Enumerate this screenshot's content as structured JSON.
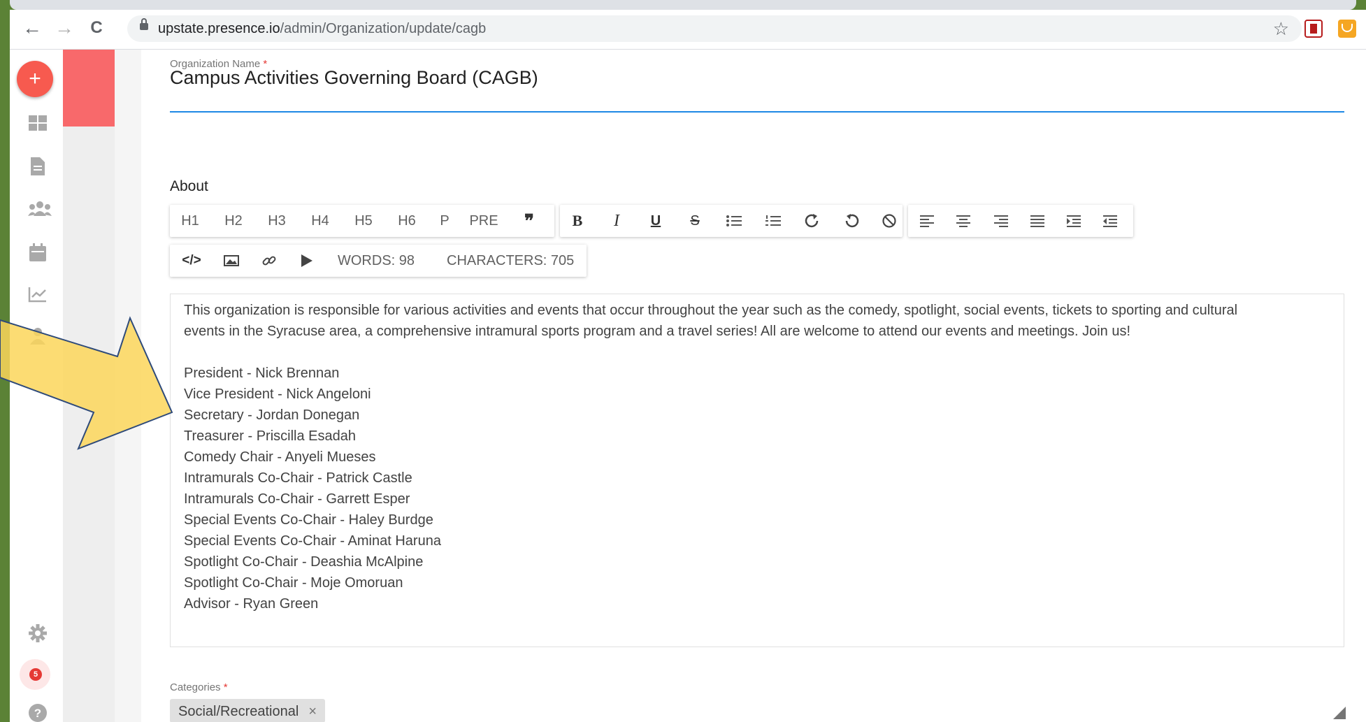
{
  "browser": {
    "url_domain": "upstate.presence.io",
    "url_path": "/admin/Organization/update/cagb",
    "back_icon": "←",
    "forward_icon": "→",
    "reload_icon": "C",
    "star_icon": "☆"
  },
  "sidebar": {
    "add_label": "+",
    "notification_count": "5"
  },
  "form": {
    "org_name_label": "Organization Name",
    "required_mark": "*",
    "org_name_value": "Campus Activities Governing Board (CAGB)",
    "about_label": "About",
    "toolbar": {
      "group1": [
        "H1",
        "H2",
        "H3",
        "H4",
        "H5",
        "H6",
        "P",
        "PRE",
        "❞"
      ],
      "group2": [
        "B",
        "I",
        "U",
        "S"
      ],
      "words": "WORDS: 98",
      "characters": "CHARACTERS: 705",
      "code_label": "</>"
    },
    "about_text": {
      "paragraph_line1": "This organization is responsible for various activities and events that occur throughout the year such as the comedy, spotlight, social events, tickets to sporting and cultural",
      "paragraph_line2": "events in the Syracuse area, a comprehensive intramural sports program and a travel series! All are welcome to attend our events and meetings. Join us!",
      "officers": [
        "President - Nick Brennan",
        "Vice President - Nick Angeloni",
        "Secretary - Jordan Donegan",
        "Treasurer - Priscilla Esadah",
        "Comedy Chair - Anyeli Mueses",
        "Intramurals Co-Chair - Patrick Castle",
        "Intramurals Co-Chair - Garrett Esper",
        "Special Events Co-Chair - Haley Burdge",
        "Special Events Co-Chair - Aminat Haruna",
        "Spotlight Co-Chair - Deashia McAlpine",
        "Spotlight Co-Chair - Moje Omoruan",
        "Advisor - Ryan Green"
      ]
    },
    "categories_label": "Categories",
    "category_chip": "Social/Recreational",
    "chip_remove": "×"
  },
  "colors": {
    "accent_blue": "#1e88e5",
    "fab_red": "#f75a4f",
    "arrow_yellow": "#fbd65a",
    "slide_green": "#5b8236"
  }
}
